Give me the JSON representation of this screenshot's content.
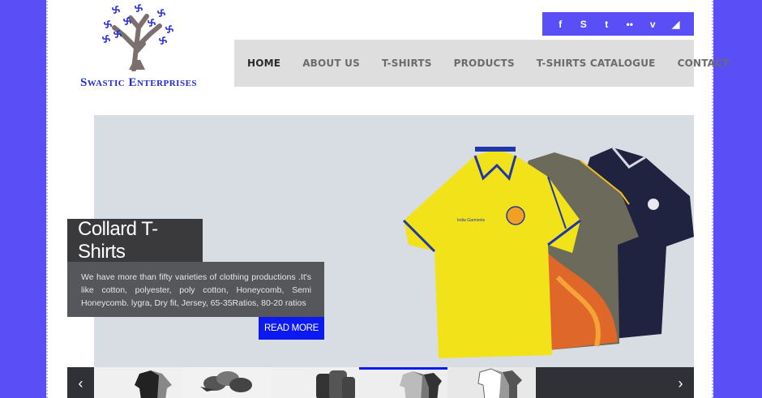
{
  "brand": {
    "name": "Swastic Enterprises"
  },
  "social": [
    {
      "icon": "facebook-icon",
      "glyph": "f"
    },
    {
      "icon": "skype-icon",
      "glyph": "S"
    },
    {
      "icon": "tumblr-icon",
      "glyph": "t"
    },
    {
      "icon": "flickr-icon",
      "glyph": "••"
    },
    {
      "icon": "vimeo-icon",
      "glyph": "v"
    },
    {
      "icon": "rss-icon",
      "glyph": "◢"
    }
  ],
  "nav": {
    "items": [
      {
        "label": "HOME",
        "active": true
      },
      {
        "label": "ABOUT US"
      },
      {
        "label": "T-SHIRTS"
      },
      {
        "label": "PRODUCTS"
      },
      {
        "label": "T-SHIRTS CATALOGUE"
      },
      {
        "label": "CONTACT"
      }
    ]
  },
  "slide": {
    "title": "Collard T-Shirts",
    "description": "We have more than fifty varieties of clothing productions .It's like cotton, polyester, poly cotton, Honeycomb, Semi Honeycomb. lygra, Dry fit, Jersey, 65-35Ratios, 80-20 ratios",
    "button": "Read More",
    "shirt_logo_text": "India Garments"
  },
  "thumbnails": {
    "prev": "‹",
    "next": "›",
    "active_index": 3
  },
  "colors": {
    "background": "#5a4ff6",
    "accent": "#0c19f0",
    "brand_text": "#1f2bd0"
  }
}
